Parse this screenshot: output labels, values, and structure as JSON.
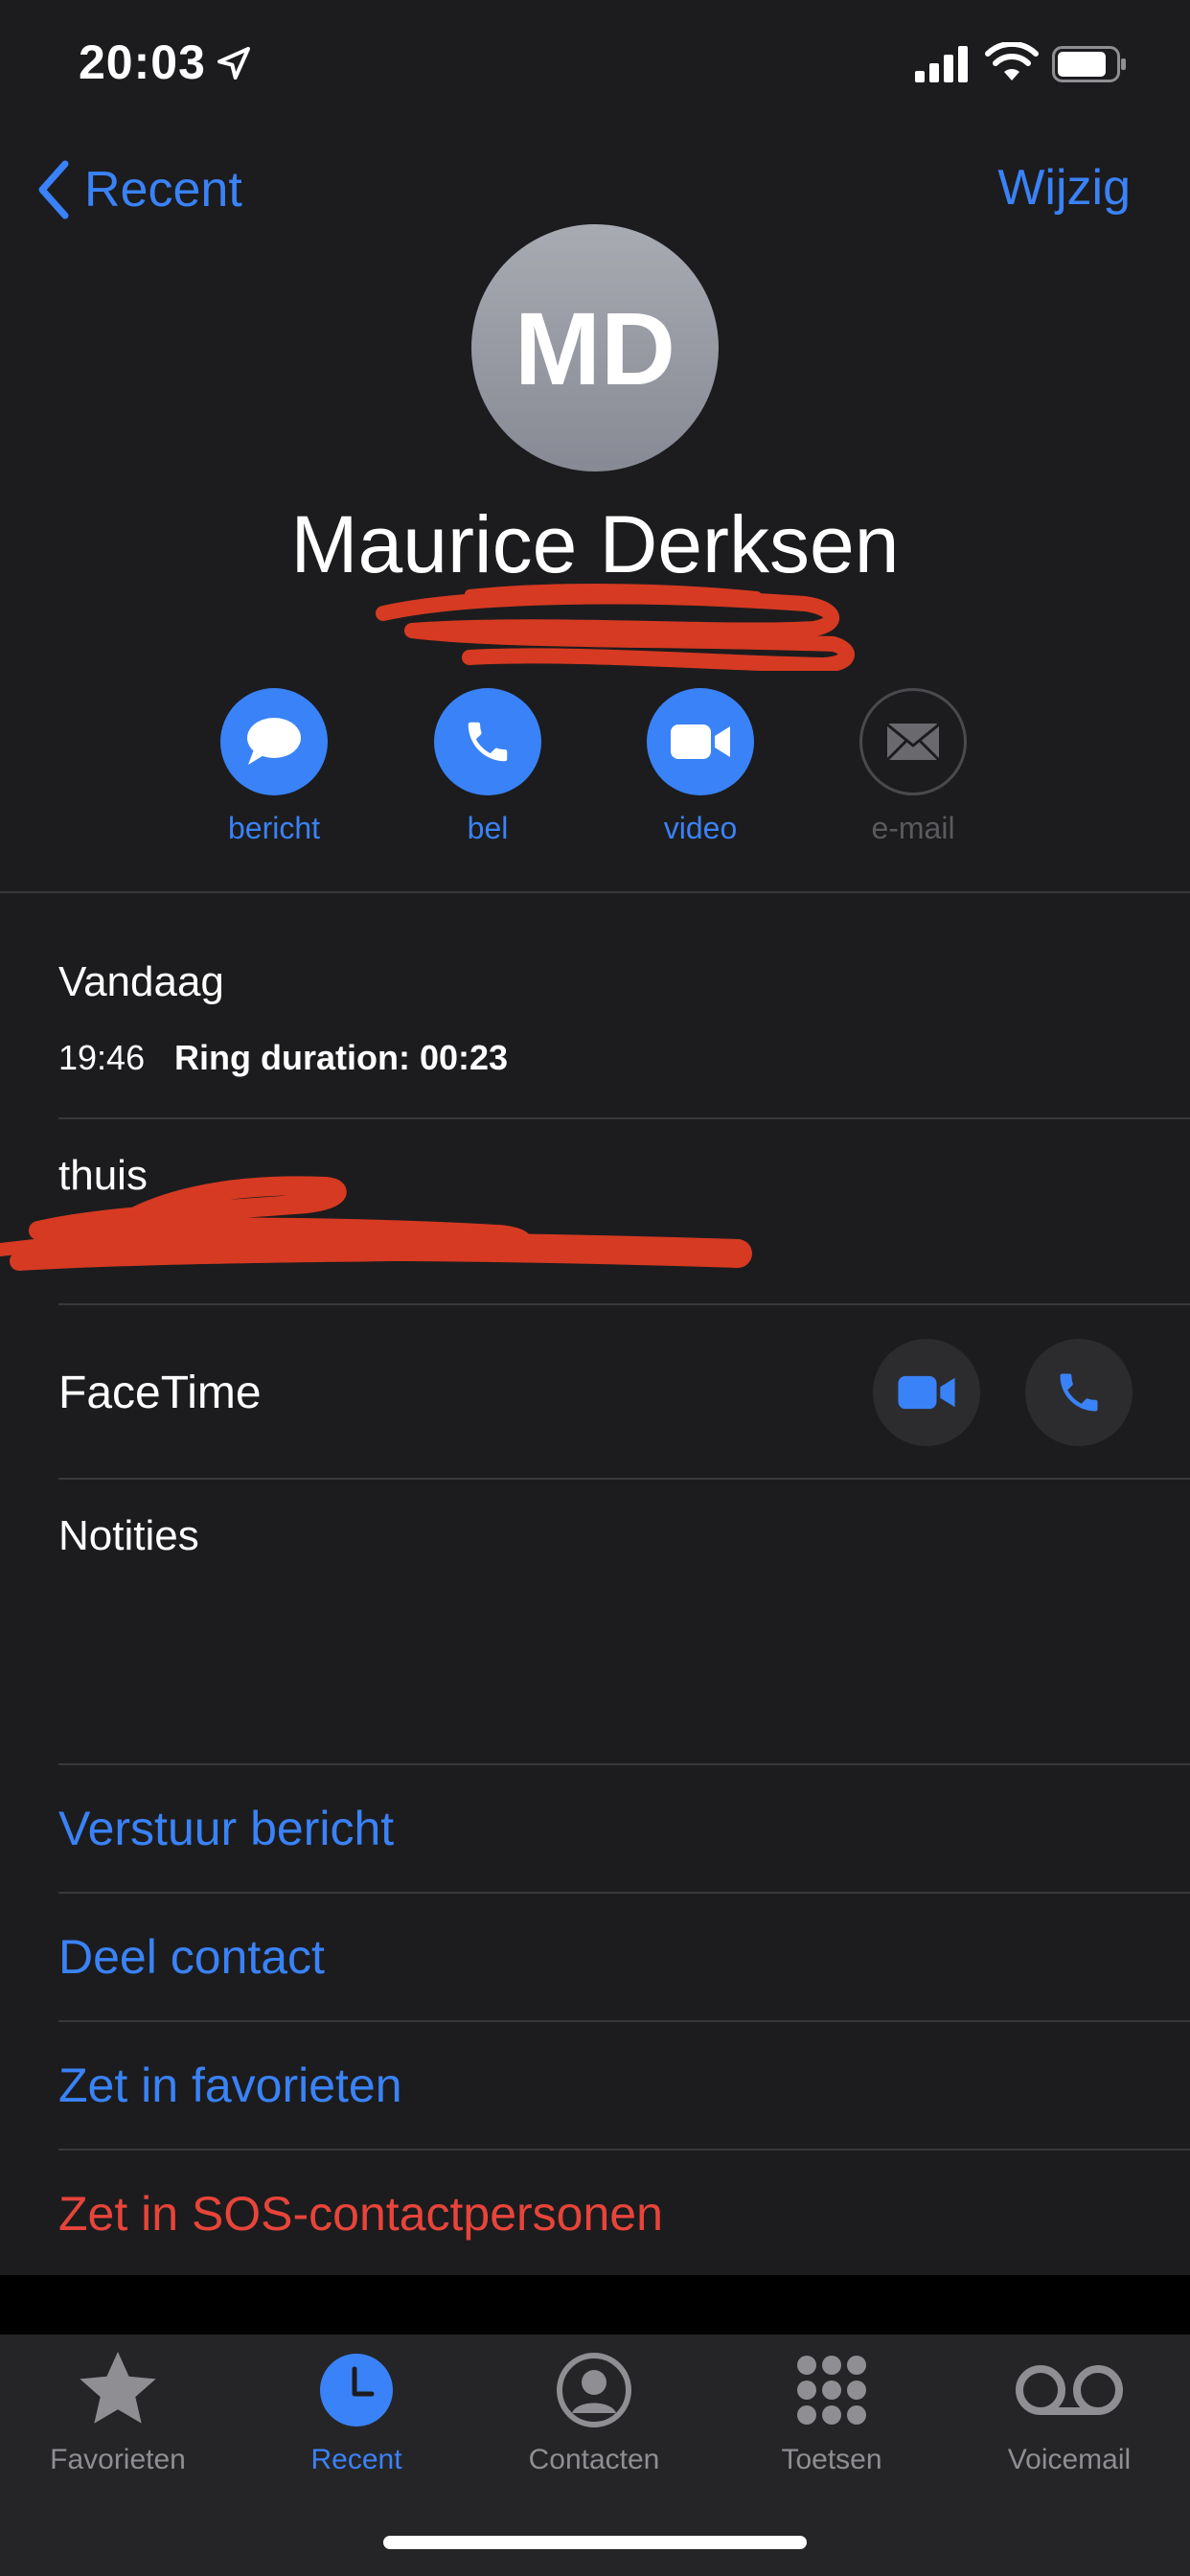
{
  "status_bar": {
    "time": "20:03"
  },
  "nav": {
    "back_label": "Recent",
    "edit_label": "Wijzig"
  },
  "contact": {
    "initials": "MD",
    "name": "Maurice Derksen"
  },
  "actions": [
    {
      "label": "bericht",
      "icon": "message-icon",
      "enabled": true
    },
    {
      "label": "bel",
      "icon": "phone-icon",
      "enabled": true
    },
    {
      "label": "video",
      "icon": "video-icon",
      "enabled": true
    },
    {
      "label": "e-mail",
      "icon": "mail-icon",
      "enabled": false
    }
  ],
  "call_log": {
    "day": "Vandaag",
    "time": "19:46",
    "detail": "Ring duration: 00:23"
  },
  "phone": {
    "label": "thuis"
  },
  "facetime": {
    "label": "FaceTime"
  },
  "notes": {
    "label": "Notities"
  },
  "links": [
    {
      "label": "Verstuur bericht",
      "color": "#3a82f7"
    },
    {
      "label": "Deel contact",
      "color": "#3a82f7"
    },
    {
      "label": "Zet in favorieten",
      "color": "#3a82f7"
    },
    {
      "label": "Zet in SOS-contactpersonen",
      "color": "#e8443a"
    }
  ],
  "tabs": [
    {
      "label": "Favorieten",
      "icon": "star-icon",
      "active": false
    },
    {
      "label": "Recent",
      "icon": "clock-icon",
      "active": true
    },
    {
      "label": "Contacten",
      "icon": "contact-icon",
      "active": false
    },
    {
      "label": "Toetsen",
      "icon": "keypad-icon",
      "active": false
    },
    {
      "label": "Voicemail",
      "icon": "voicemail-icon",
      "active": false
    }
  ],
  "colors": {
    "accent": "#3a82f7",
    "destructive": "#e8443a",
    "background": "#1c1c1e",
    "redaction": "#d63a22"
  }
}
